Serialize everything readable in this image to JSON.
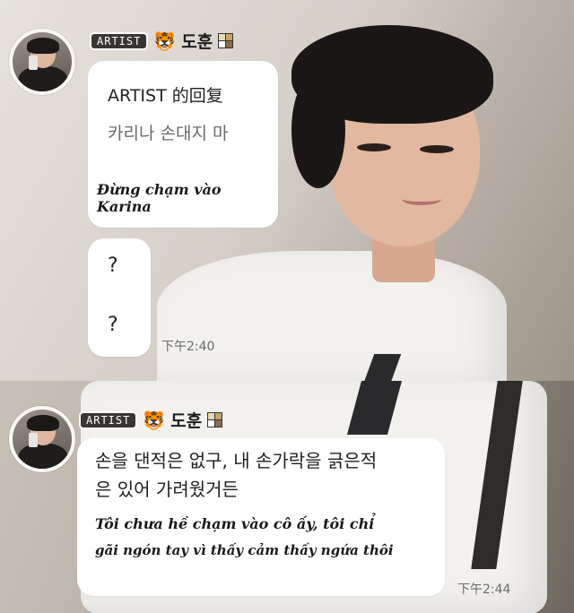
{
  "top": {
    "badge": "ARTIST",
    "username": "도훈",
    "icons": {
      "left": "tiger-emoji-icon",
      "right": "grid-sticker-icon"
    },
    "reply": {
      "title": "ARTIST 的回复",
      "korean": "카리나 손대지 마",
      "translation": "Đừng chạm vào Karina"
    },
    "question_bubble": {
      "lines": [
        "?",
        "?"
      ]
    },
    "time": "下午2:40"
  },
  "bottom": {
    "badge": "ARTIST",
    "username": "도훈",
    "icons": {
      "left": "tiger-emoji-icon",
      "right": "grid-sticker-icon"
    },
    "korean_lines": [
      "손을 댄적은 없구, 내 손가락을 긁은적",
      "은 있어 가려웠거든"
    ],
    "translation_lines": [
      "Tôi chưa hề chạm vào cô ấy, tôi chỉ",
      "gãi ngón tay vì thấy cảm thấy ngứa thôi"
    ],
    "time": "下午2:44"
  },
  "colors": {
    "bubble": "#ffffff",
    "badge_bg": "#3a3532",
    "text": "#1a1a1a",
    "muted": "#6a6a6a"
  }
}
